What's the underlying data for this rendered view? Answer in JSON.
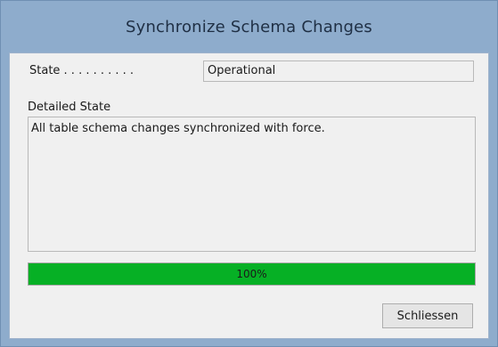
{
  "window": {
    "title": "Synchronize Schema Changes"
  },
  "state": {
    "label": "State . . . . . . . . . .",
    "value": "Operational"
  },
  "detail": {
    "label": "Detailed State",
    "text": "All table schema changes synchronized with force."
  },
  "progress": {
    "percent": 100,
    "label": "100%",
    "color": "#06b025"
  },
  "buttons": {
    "close_label": "Schliessen"
  }
}
